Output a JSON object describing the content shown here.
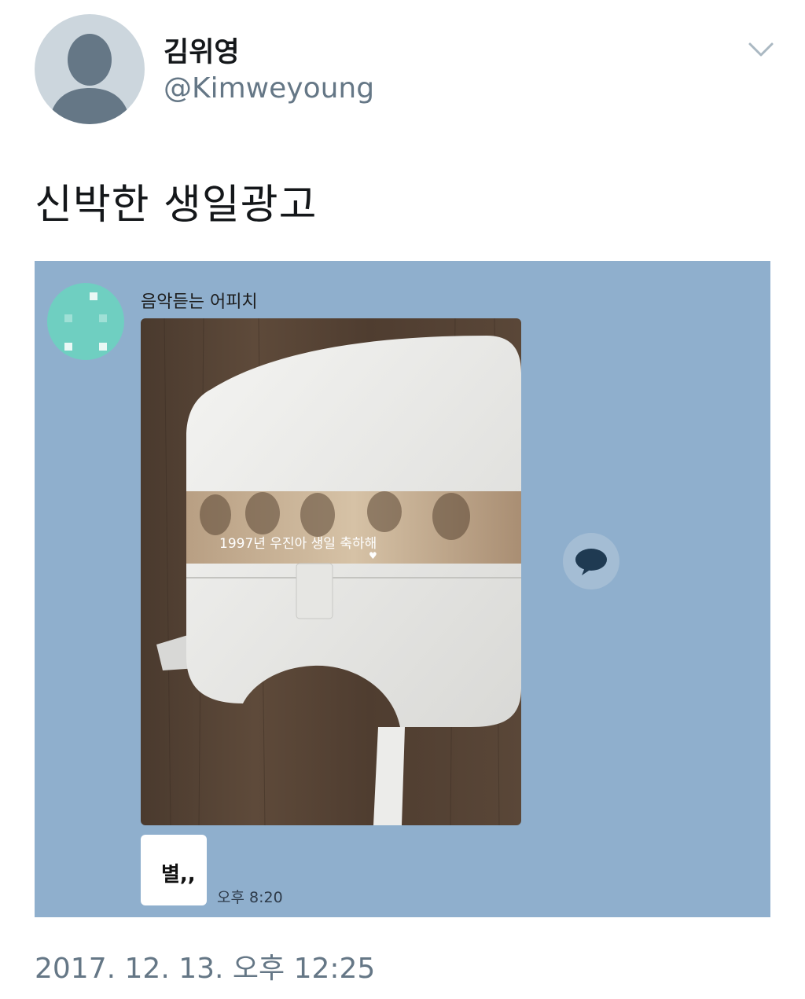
{
  "tweet": {
    "display_name": "김위영",
    "handle": "@Kimweyoung",
    "text": "신박한 생일광고",
    "timestamp": "2017. 12. 13. 오후 12:25"
  },
  "chat": {
    "sender": "음악듣는 어피치",
    "message": "별,,",
    "time": "오후 8:20"
  },
  "photo": {
    "banner_text": "1997년 우진아 생일 축하해",
    "banner_subtext": "♥"
  },
  "icons": {
    "menu": "chevron-down-icon",
    "share": "speech-bubble-icon",
    "avatar": "default-profile-icon"
  },
  "colors": {
    "chat_background": "#8fafcd",
    "handle": "#657786",
    "chat_avatar": "#6fcfc1"
  }
}
